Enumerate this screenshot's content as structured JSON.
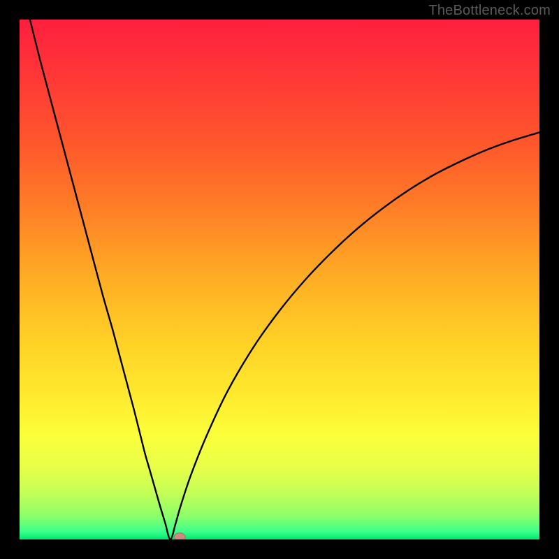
{
  "watermark": "TheBottleneck.com",
  "colors": {
    "background": "#000000",
    "curve": "#000000",
    "marker_fill": "#cf8a81",
    "marker_stroke": "#b36b61",
    "gradient_stops": [
      {
        "offset": 0.0,
        "color": "#ff1f3f"
      },
      {
        "offset": 0.12,
        "color": "#ff3a36"
      },
      {
        "offset": 0.25,
        "color": "#ff5a2b"
      },
      {
        "offset": 0.38,
        "color": "#ff8426"
      },
      {
        "offset": 0.5,
        "color": "#ffae24"
      },
      {
        "offset": 0.62,
        "color": "#ffd126"
      },
      {
        "offset": 0.72,
        "color": "#ffe92e"
      },
      {
        "offset": 0.8,
        "color": "#fbff3a"
      },
      {
        "offset": 0.86,
        "color": "#e8ff48"
      },
      {
        "offset": 0.91,
        "color": "#c4ff56"
      },
      {
        "offset": 0.955,
        "color": "#8cff6a"
      },
      {
        "offset": 0.985,
        "color": "#3bff8c"
      },
      {
        "offset": 1.0,
        "color": "#00e870"
      }
    ]
  },
  "chart_data": {
    "type": "line",
    "title": "",
    "xlabel": "",
    "ylabel": "",
    "xlim": [
      0,
      100
    ],
    "ylim": [
      0,
      100
    ],
    "grid": false,
    "legend": false,
    "optimum_x": 29,
    "marker": {
      "x": 30.8,
      "y": 0.5
    },
    "series": [
      {
        "name": "bottleneck-curve",
        "x": [
          0,
          2,
          4,
          6,
          8,
          10,
          12,
          14,
          16,
          18,
          20,
          22,
          24,
          25,
          26,
          27,
          28,
          29,
          30,
          31,
          33,
          36,
          40,
          45,
          50,
          55,
          60,
          65,
          70,
          75,
          80,
          85,
          90,
          95,
          100
        ],
        "y": [
          108,
          100,
          92,
          84.5,
          77,
          69.5,
          62,
          54.5,
          47,
          40,
          32.5,
          25,
          17,
          13.5,
          10,
          6.5,
          3.2,
          0,
          3,
          6.5,
          12.5,
          20,
          28.5,
          37,
          44,
          50,
          55.2,
          59.8,
          63.8,
          67.3,
          70.3,
          72.8,
          75,
          76.8,
          78.3
        ]
      }
    ]
  }
}
